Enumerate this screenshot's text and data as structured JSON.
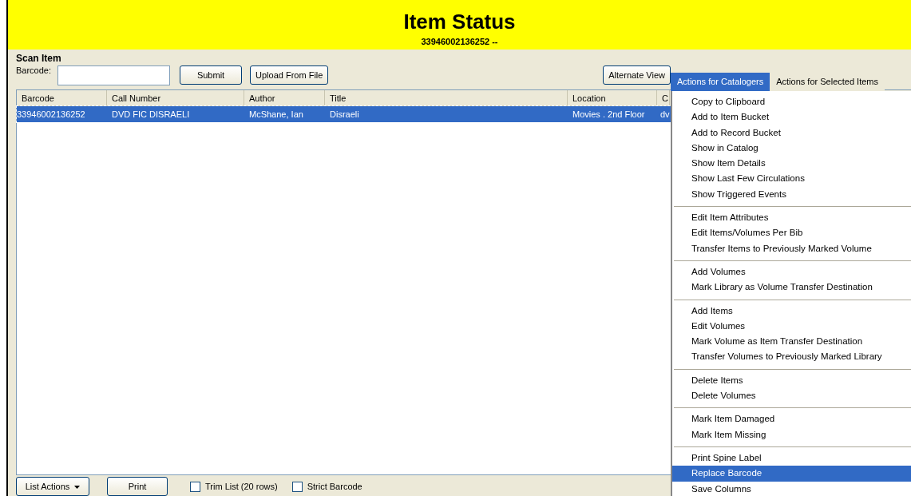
{
  "header": {
    "title": "Item Status",
    "subtitle": "33946002136252 --"
  },
  "scan": {
    "legend": "Scan Item",
    "barcode_label": "Barcode:",
    "buttons": [
      "Submit",
      "Upload From File"
    ],
    "alternate_view": "Alternate View"
  },
  "tabs": [
    {
      "label": "Actions for Catalogers",
      "selected": true
    },
    {
      "label": "Actions for Selected Items",
      "selected": false
    }
  ],
  "list": {
    "columns": [
      "Barcode",
      "Call Number",
      "Author",
      "Title",
      "Location",
      "C"
    ],
    "rows": [
      {
        "cells": [
          "33946002136252",
          "DVD FIC DISRAELI",
          "McShane, Ian",
          "Disraeli",
          "Movies . 2nd Floor",
          "dv"
        ],
        "selected": true
      }
    ]
  },
  "menu": {
    "groups": [
      [
        {
          "label": "Copy to Clipboard",
          "selected": false
        },
        {
          "label": "Add to Item Bucket",
          "selected": false
        },
        {
          "label": "Add to Record Bucket",
          "selected": false
        },
        {
          "label": "Show in Catalog",
          "selected": false
        },
        {
          "label": "Show Item Details",
          "selected": false
        },
        {
          "label": "Show Last Few Circulations",
          "selected": false
        },
        {
          "label": "Show Triggered Events",
          "selected": false
        }
      ],
      [
        {
          "label": "Edit Item Attributes",
          "selected": false
        },
        {
          "label": "Edit Items/Volumes Per Bib",
          "selected": false
        },
        {
          "label": "Transfer Items to Previously Marked Volume",
          "selected": false
        }
      ],
      [
        {
          "label": "Add Volumes",
          "selected": false
        },
        {
          "label": "Mark Library as Volume Transfer Destination",
          "selected": false
        }
      ],
      [
        {
          "label": "Add Items",
          "selected": false
        },
        {
          "label": "Edit Volumes",
          "selected": false
        },
        {
          "label": "Mark Volume as Item Transfer Destination",
          "selected": false
        },
        {
          "label": "Transfer Volumes to Previously Marked Library",
          "selected": false
        }
      ],
      [
        {
          "label": "Delete Items",
          "selected": false
        },
        {
          "label": "Delete Volumes",
          "selected": false
        }
      ],
      [
        {
          "label": "Mark Item Damaged",
          "selected": false
        },
        {
          "label": "Mark Item Missing",
          "selected": false
        }
      ],
      [
        {
          "label": "Print Spine Label",
          "selected": false
        },
        {
          "label": "Replace Barcode",
          "selected": true
        },
        {
          "label": "Save Columns",
          "selected": false
        }
      ]
    ]
  },
  "footer": {
    "list_actions": "List Actions",
    "print": "Print",
    "checkboxes": [
      {
        "label": "Trim List (20 rows)",
        "checked": false
      },
      {
        "label": "Strict Barcode",
        "checked": false
      }
    ]
  }
}
